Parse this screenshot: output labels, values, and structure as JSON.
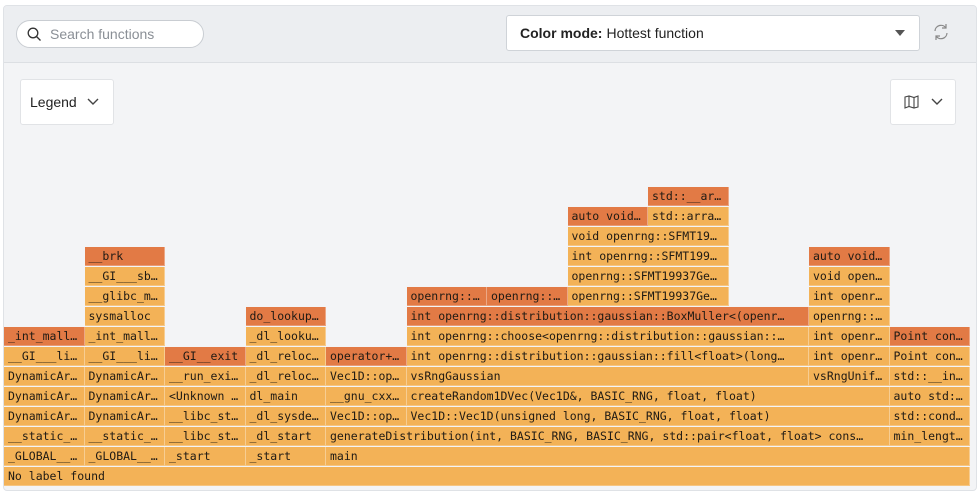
{
  "toolbar": {
    "search_placeholder": "Search functions",
    "search_value": "",
    "color_mode_label": "Color mode:",
    "color_mode_value": "Hottest function",
    "refresh_icon": "refresh-icon"
  },
  "controls": {
    "legend_label": "Legend",
    "minimap_icon": "map-icon"
  },
  "colors": {
    "hot": "#e27a45",
    "normal": "#f3b257",
    "background": "#f3f4f6"
  },
  "flamegraph": {
    "total_units": 12,
    "frames": [
      {
        "label": "No label found",
        "depth": 0,
        "start": 0,
        "width": 12,
        "hot": false
      },
      {
        "label": "_GLOBAL__…",
        "depth": 1,
        "start": 0,
        "width": 1,
        "hot": false
      },
      {
        "label": "__static_…",
        "depth": 2,
        "start": 0,
        "width": 1,
        "hot": false
      },
      {
        "label": "DynamicAr…",
        "depth": 3,
        "start": 0,
        "width": 1,
        "hot": false
      },
      {
        "label": "DynamicAr…",
        "depth": 4,
        "start": 0,
        "width": 1,
        "hot": false
      },
      {
        "label": "DynamicAr…",
        "depth": 5,
        "start": 0,
        "width": 1,
        "hot": false
      },
      {
        "label": "__GI___li…",
        "depth": 6,
        "start": 0,
        "width": 1,
        "hot": false
      },
      {
        "label": "_int_mall…",
        "depth": 7,
        "start": 0,
        "width": 1,
        "hot": true
      },
      {
        "label": "_GLOBAL__…",
        "depth": 1,
        "start": 1,
        "width": 1,
        "hot": false
      },
      {
        "label": "__static_…",
        "depth": 2,
        "start": 1,
        "width": 1,
        "hot": false
      },
      {
        "label": "DynamicAr…",
        "depth": 3,
        "start": 1,
        "width": 1,
        "hot": false
      },
      {
        "label": "DynamicAr…",
        "depth": 4,
        "start": 1,
        "width": 1,
        "hot": false
      },
      {
        "label": "DynamicAr…",
        "depth": 5,
        "start": 1,
        "width": 1,
        "hot": false
      },
      {
        "label": "__GI___li…",
        "depth": 6,
        "start": 1,
        "width": 1,
        "hot": false
      },
      {
        "label": "_int_mall…",
        "depth": 7,
        "start": 1,
        "width": 1,
        "hot": false
      },
      {
        "label": "sysmalloc",
        "depth": 8,
        "start": 1,
        "width": 1,
        "hot": false
      },
      {
        "label": "__glibc_m…",
        "depth": 9,
        "start": 1,
        "width": 1,
        "hot": false
      },
      {
        "label": "__GI___sb…",
        "depth": 10,
        "start": 1,
        "width": 1,
        "hot": false
      },
      {
        "label": "__brk",
        "depth": 11,
        "start": 1,
        "width": 1,
        "hot": true
      },
      {
        "label": "_start",
        "depth": 1,
        "start": 2,
        "width": 1,
        "hot": false
      },
      {
        "label": "__libc_st…",
        "depth": 2,
        "start": 2,
        "width": 1,
        "hot": false
      },
      {
        "label": "__libc_st…",
        "depth": 3,
        "start": 2,
        "width": 1,
        "hot": false
      },
      {
        "label": "<Unknown …",
        "depth": 4,
        "start": 2,
        "width": 1,
        "hot": false
      },
      {
        "label": "__run_exi…",
        "depth": 5,
        "start": 2,
        "width": 1,
        "hot": false
      },
      {
        "label": "__GI__exit",
        "depth": 6,
        "start": 2,
        "width": 1,
        "hot": true
      },
      {
        "label": "_start",
        "depth": 1,
        "start": 3,
        "width": 1,
        "hot": false
      },
      {
        "label": "_dl_start",
        "depth": 2,
        "start": 3,
        "width": 1,
        "hot": false
      },
      {
        "label": "_dl_sysde…",
        "depth": 3,
        "start": 3,
        "width": 1,
        "hot": false
      },
      {
        "label": "dl_main",
        "depth": 4,
        "start": 3,
        "width": 1,
        "hot": false
      },
      {
        "label": "_dl_reloc…",
        "depth": 5,
        "start": 3,
        "width": 1,
        "hot": false
      },
      {
        "label": "_dl_reloc…",
        "depth": 6,
        "start": 3,
        "width": 1,
        "hot": false
      },
      {
        "label": "_dl_looku…",
        "depth": 7,
        "start": 3,
        "width": 1,
        "hot": false
      },
      {
        "label": "do_lookup…",
        "depth": 8,
        "start": 3,
        "width": 1,
        "hot": true
      },
      {
        "label": "main",
        "depth": 1,
        "start": 4,
        "width": 8,
        "hot": false
      },
      {
        "label": "generateDistribution(int, BASIC_RNG, BASIC_RNG, std::pair<float, float> cons…",
        "depth": 2,
        "start": 4,
        "width": 7,
        "hot": false
      },
      {
        "label": "Vec1D::op…",
        "depth": 3,
        "start": 4,
        "width": 1,
        "hot": false
      },
      {
        "label": "__gnu_cxx…",
        "depth": 4,
        "start": 4,
        "width": 1,
        "hot": false
      },
      {
        "label": "Vec1D::op…",
        "depth": 5,
        "start": 4,
        "width": 1,
        "hot": false
      },
      {
        "label": "operator+…",
        "depth": 6,
        "start": 4,
        "width": 1,
        "hot": true
      },
      {
        "label": "Vec1D::Vec1D(unsigned long, BASIC_RNG, float, float)",
        "depth": 3,
        "start": 5,
        "width": 6,
        "hot": false
      },
      {
        "label": "createRandom1DVec(Vec1D&, BASIC_RNG, float, float)",
        "depth": 4,
        "start": 5,
        "width": 6,
        "hot": false
      },
      {
        "label": "vsRngGaussian",
        "depth": 5,
        "start": 5,
        "width": 5,
        "hot": false
      },
      {
        "label": "int openrng::distribution::gaussian::fill<float>(long…",
        "depth": 6,
        "start": 5,
        "width": 5,
        "hot": false
      },
      {
        "label": "int openrng::choose<openrng::distribution::gaussian::…",
        "depth": 7,
        "start": 5,
        "width": 5,
        "hot": false
      },
      {
        "label": "int openrng::distribution::gaussian::BoxMuller<(openr…",
        "depth": 8,
        "start": 5,
        "width": 5,
        "hot": true
      },
      {
        "label": "openrng::…",
        "depth": 9,
        "start": 5,
        "width": 1,
        "hot": true
      },
      {
        "label": "openrng::…",
        "depth": 9,
        "start": 6,
        "width": 1,
        "hot": true
      },
      {
        "label": "openrng::SFMT19937Ge…",
        "depth": 9,
        "start": 7,
        "width": 2,
        "hot": false
      },
      {
        "label": "openrng::SFMT19937Ge…",
        "depth": 10,
        "start": 7,
        "width": 2,
        "hot": false
      },
      {
        "label": "int openrng::SFMT199…",
        "depth": 11,
        "start": 7,
        "width": 2,
        "hot": false
      },
      {
        "label": "void openrng::SFMT19…",
        "depth": 12,
        "start": 7,
        "width": 2,
        "hot": false
      },
      {
        "label": "auto void…",
        "depth": 13,
        "start": 7,
        "width": 1,
        "hot": true
      },
      {
        "label": "std::arra…",
        "depth": 13,
        "start": 8,
        "width": 1,
        "hot": false
      },
      {
        "label": "std::__ar…",
        "depth": 14,
        "start": 8,
        "width": 1,
        "hot": true
      },
      {
        "label": "vsRngUnif…",
        "depth": 5,
        "start": 10,
        "width": 1,
        "hot": false
      },
      {
        "label": "int openr…",
        "depth": 6,
        "start": 10,
        "width": 1,
        "hot": false
      },
      {
        "label": "int openr…",
        "depth": 7,
        "start": 10,
        "width": 1,
        "hot": false
      },
      {
        "label": "openrng::…",
        "depth": 8,
        "start": 10,
        "width": 1,
        "hot": false
      },
      {
        "label": "int openr…",
        "depth": 9,
        "start": 10,
        "width": 1,
        "hot": false
      },
      {
        "label": "void open…",
        "depth": 10,
        "start": 10,
        "width": 1,
        "hot": false
      },
      {
        "label": "auto void…",
        "depth": 11,
        "start": 10,
        "width": 1,
        "hot": true
      },
      {
        "label": "min_lengt…",
        "depth": 2,
        "start": 11,
        "width": 1,
        "hot": false
      },
      {
        "label": "std::cond…",
        "depth": 3,
        "start": 11,
        "width": 1,
        "hot": false
      },
      {
        "label": "auto std:…",
        "depth": 4,
        "start": 11,
        "width": 1,
        "hot": false
      },
      {
        "label": "std::__in…",
        "depth": 5,
        "start": 11,
        "width": 1,
        "hot": false
      },
      {
        "label": "Point con…",
        "depth": 6,
        "start": 11,
        "width": 1,
        "hot": false
      },
      {
        "label": "Point con…",
        "depth": 7,
        "start": 11,
        "width": 1,
        "hot": true
      }
    ]
  }
}
